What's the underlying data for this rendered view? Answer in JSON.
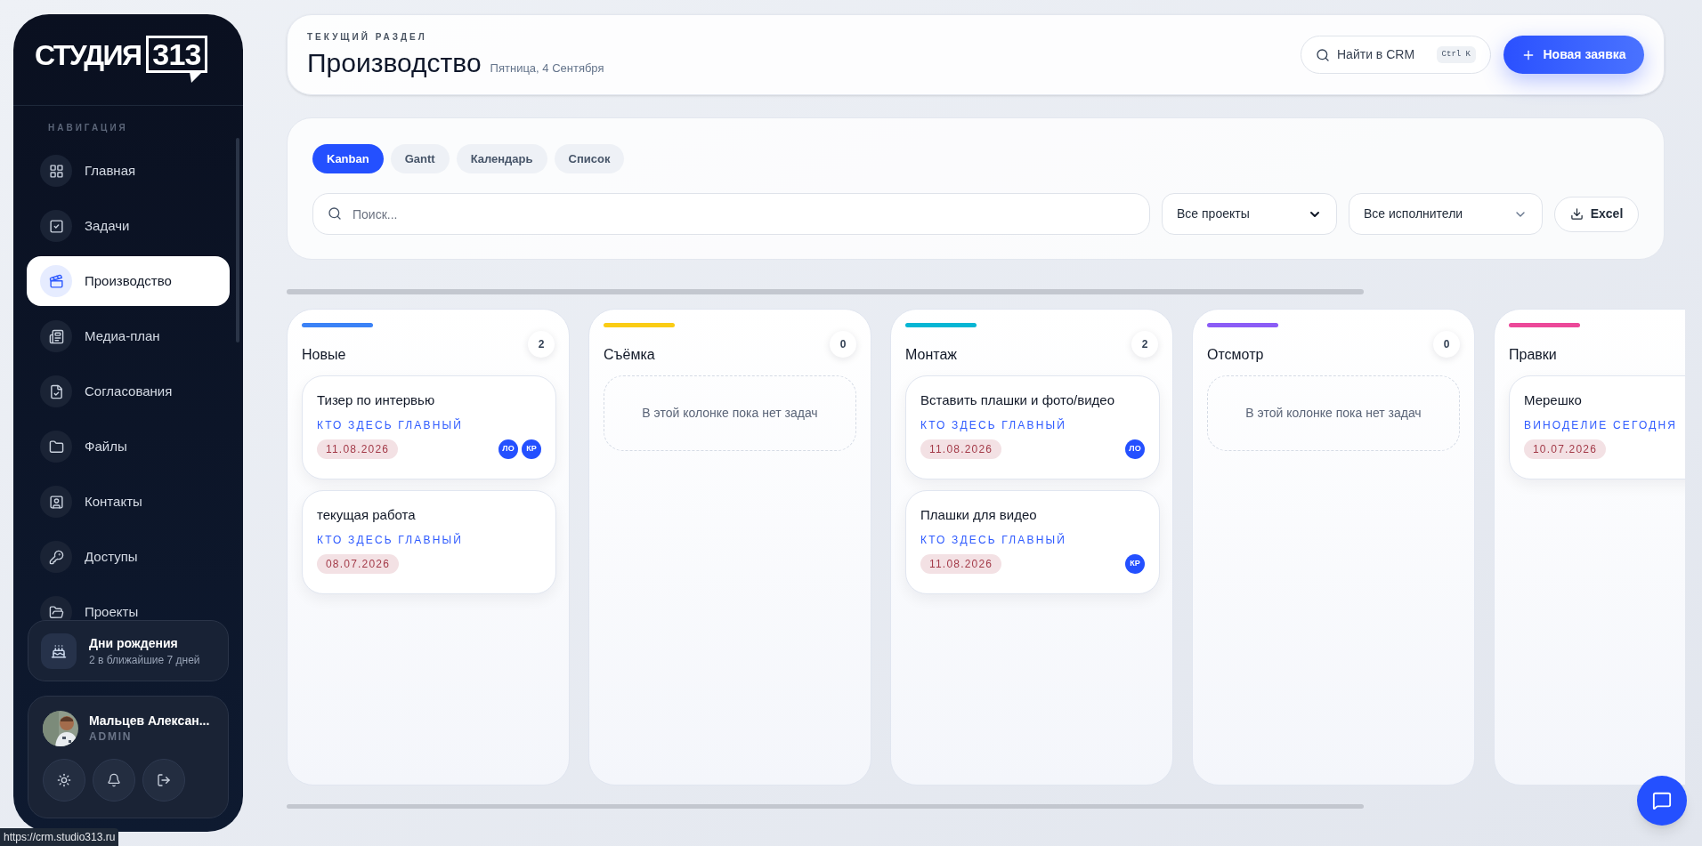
{
  "sidebar": {
    "logo": {
      "word": "СТУДИЯ",
      "number": "313"
    },
    "section_label": "НАВИГАЦИЯ",
    "items": [
      {
        "label": "Главная",
        "selected": false
      },
      {
        "label": "Задачи",
        "selected": false
      },
      {
        "label": "Производство",
        "selected": true
      },
      {
        "label": "Медиа-план",
        "selected": false
      },
      {
        "label": "Согласования",
        "selected": false
      },
      {
        "label": "Файлы",
        "selected": false
      },
      {
        "label": "Контакты",
        "selected": false
      },
      {
        "label": "Доступы",
        "selected": false
      },
      {
        "label": "Проекты",
        "selected": false
      }
    ],
    "birthdays": {
      "title": "Дни рождения",
      "subtitle": "2 в ближайшие 7 дней"
    },
    "user": {
      "name": "Мальцев Алексан...",
      "role": "ADMIN"
    }
  },
  "header": {
    "eyebrow": "ТЕКУЩИЙ РАЗДЕЛ",
    "title": "Производство",
    "date": "Пятница, 4 Сентября",
    "search_label": "Найти в CRM",
    "shortcut": "Ctrl K",
    "new_button": "Новая заявка"
  },
  "toolbar": {
    "tabs": [
      {
        "label": "Kanban",
        "selected": true
      },
      {
        "label": "Gantt",
        "selected": false
      },
      {
        "label": "Календарь",
        "selected": false
      },
      {
        "label": "Список",
        "selected": false
      }
    ],
    "search": {
      "placeholder": "Поиск..."
    },
    "project_filter": "Все проекты",
    "assignee_filter": "Все исполнители",
    "export_button": "Excel"
  },
  "columns": [
    {
      "title": "Новые",
      "count": "2",
      "color": "#3b82f6",
      "cards": [
        {
          "title": "Тизер по интервью",
          "project": "КТО ЗДЕСЬ ГЛАВНЫЙ",
          "date": "11.08.2026",
          "assignees": [
            "ЛО",
            "КР"
          ]
        },
        {
          "title": "текущая работа",
          "project": "КТО ЗДЕСЬ ГЛАВНЫЙ",
          "date": "08.07.2026"
        }
      ]
    },
    {
      "title": "Съёмка",
      "count": "0",
      "color": "#facc15",
      "empty_text": "В этой колонке пока нет задач"
    },
    {
      "title": "Монтаж",
      "count": "2",
      "color": "#06b6d4",
      "cards": [
        {
          "title": "Вставить плашки и фото/видео",
          "project": "КТО ЗДЕСЬ ГЛАВНЫЙ",
          "date": "11.08.2026",
          "assignees": [
            "ЛО"
          ]
        },
        {
          "title": "Плашки для видео",
          "project": "КТО ЗДЕСЬ ГЛАВНЫЙ",
          "date": "11.08.2026",
          "assignees": [
            "КР"
          ]
        }
      ]
    },
    {
      "title": "Отсмотр",
      "count": "0",
      "color": "#8b5cf6",
      "empty_text": "В этой колонке пока нет задач"
    },
    {
      "title": "Правки",
      "color": "#ec4899",
      "cards": [
        {
          "title": "Мерешко",
          "project": "ВИНОДЕЛИЕ СЕГОДНЯ",
          "date": "10.07.2026"
        }
      ]
    }
  ],
  "status_url": "https://crm.studio313.ru"
}
